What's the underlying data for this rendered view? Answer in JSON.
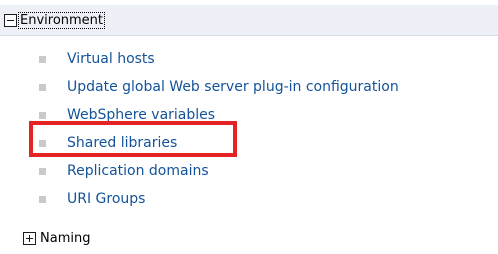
{
  "environment": {
    "label": "Environment",
    "toggle_icon": "collapse-minus-icon"
  },
  "items": [
    {
      "label": "Virtual hosts"
    },
    {
      "label": "Update global Web server plug-in configuration"
    },
    {
      "label": "WebSphere variables"
    },
    {
      "label": "Shared libraries"
    },
    {
      "label": "Replication domains"
    },
    {
      "label": "URI Groups"
    }
  ],
  "naming": {
    "label": "Naming",
    "toggle_icon": "expand-plus-icon"
  },
  "highlight": {
    "color": "#e52324",
    "target": "Shared libraries"
  },
  "colors": {
    "link": "#14539a",
    "header_bg": "#eef0f8",
    "bullet": "#c9c9c9"
  }
}
